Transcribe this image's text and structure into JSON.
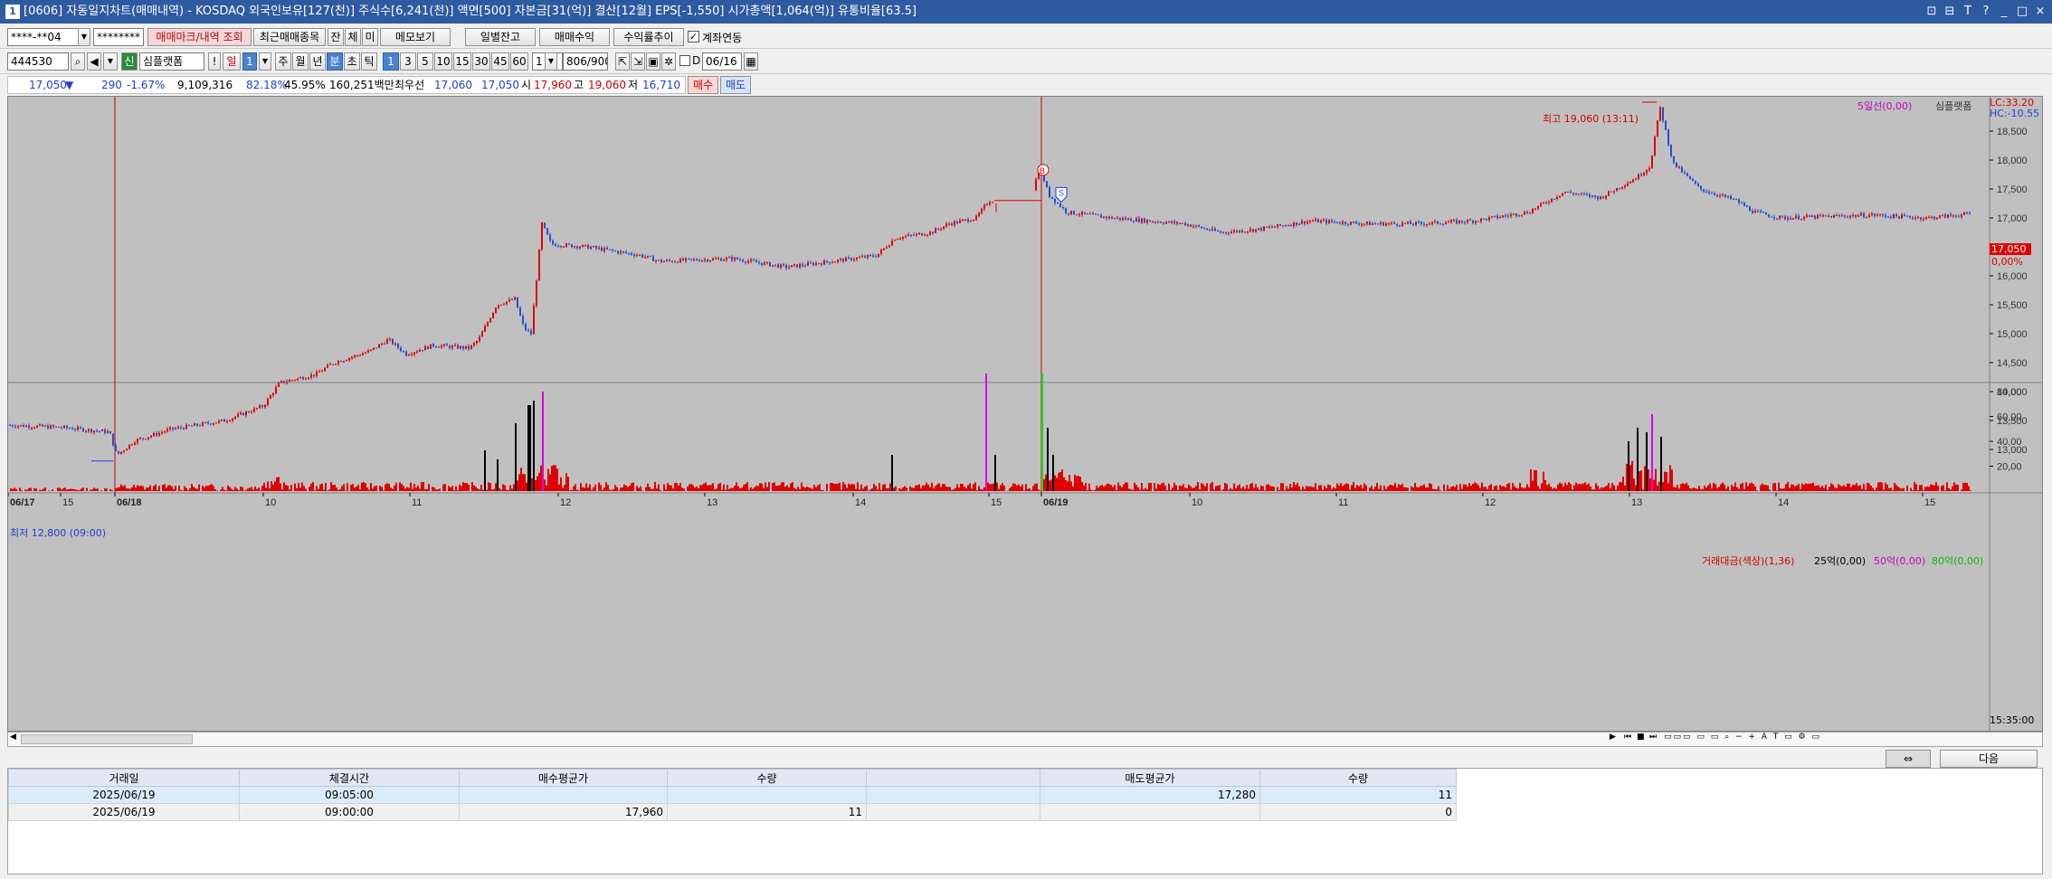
{
  "window": {
    "title": "[0606] 자동일지차트(매매내역) - KOSDAQ 외국인보유[127(천)] 주식수[6,241(천)] 액면[500] 자본금[31(억)] 결산[12월] EPS[-1,550] 시가총액[1,064(억)] 유통비율[63.5]",
    "icon": "1",
    "controls": [
      "⊡",
      "⊟",
      "T",
      "?",
      "_",
      "□",
      "×"
    ]
  },
  "toolbar1": {
    "account": "****-**04",
    "password": "********",
    "trade_mark_btn": "매매마크/내역 조회",
    "recent_btn": "최근매매종목",
    "jan": "잔",
    "che": "체",
    "mi": "미",
    "memo_btn": "메모보기",
    "daily_btn": "일별잔고",
    "profit_btn": "매매수익",
    "rate_btn": "수익률추이",
    "account_link_label": "계좌연동"
  },
  "toolbar2": {
    "code": "444530",
    "badge": "신",
    "stock_name": "심플랫폼",
    "periods": [
      "일",
      "1"
    ],
    "period_btns": [
      "주",
      "월",
      "년",
      "분",
      "초",
      "틱"
    ],
    "minutes": [
      "1",
      "3",
      "5",
      "10",
      "15",
      "30",
      "45",
      "60"
    ],
    "count": "1",
    "range": "806/900",
    "date_label": "D",
    "date": "06/16"
  },
  "quote": {
    "price": "17,050",
    "arrow": "▼",
    "change": "290",
    "rate": "-1.67%",
    "volume": "9,109,316",
    "vol_rate": "82.18%",
    "turnover": "45.95%",
    "amount": "160,251백만",
    "best_ask_label": "최우선",
    "best_ask": "17,060",
    "best_bid": "17,050",
    "open_label": "시",
    "open": "17,960",
    "high_label": "고",
    "high": "19,060",
    "low_label": "저",
    "low": "16,710",
    "buy_btn": "매수",
    "sell_btn": "매도"
  },
  "chart": {
    "legend_top": {
      "ma5": "5일선(0,00)",
      "name": "심플랫폼",
      "lc": "LC:33.20",
      "hc": "HC:-10.55"
    },
    "high_label": "최고 19,060 (13:11)",
    "low_label": "최저 12,800 (09:00)",
    "price_ticks": [
      "18,500",
      "18,000",
      "17,500",
      "17,000",
      "16,500",
      "16,000",
      "15,500",
      "15,000",
      "14,500",
      "14,000",
      "13,500",
      "13,000"
    ],
    "current_price": "17,050",
    "current_pct": "0,00%",
    "vol_legend": {
      "a": "거래대금(색상)(1,36)",
      "b": "25억(0,00)",
      "c": "50억(0,00)",
      "d": "80억(0,00)"
    },
    "vol_ticks": [
      "80,00",
      "60,00",
      "40,00",
      "20,00"
    ],
    "time_labels": [
      "06/17",
      "15",
      "06/18",
      "10",
      "11",
      "12",
      "13",
      "14",
      "15",
      "06/19",
      "10",
      "11",
      "12",
      "13",
      "14",
      "15"
    ],
    "end_time": "15:35:00",
    "marker_b": "B",
    "marker_s": "S",
    "colors": {
      "bg": "#c0c0c0",
      "up": "#e00000",
      "down": "#2050d0",
      "grid": "#d0d0d0"
    }
  },
  "bottom": {
    "next_btn": "다음"
  },
  "grid": {
    "headers": [
      "거래일",
      "체결시간",
      "매수평균가",
      "수량",
      "",
      "매도평균가",
      "수량"
    ],
    "rows": [
      [
        "2025/06/19",
        "09:05:00",
        "",
        "",
        "",
        "17,280",
        "11"
      ],
      [
        "2025/06/19",
        "09:00:00",
        "17,960",
        "11",
        "",
        "",
        "0"
      ]
    ]
  }
}
